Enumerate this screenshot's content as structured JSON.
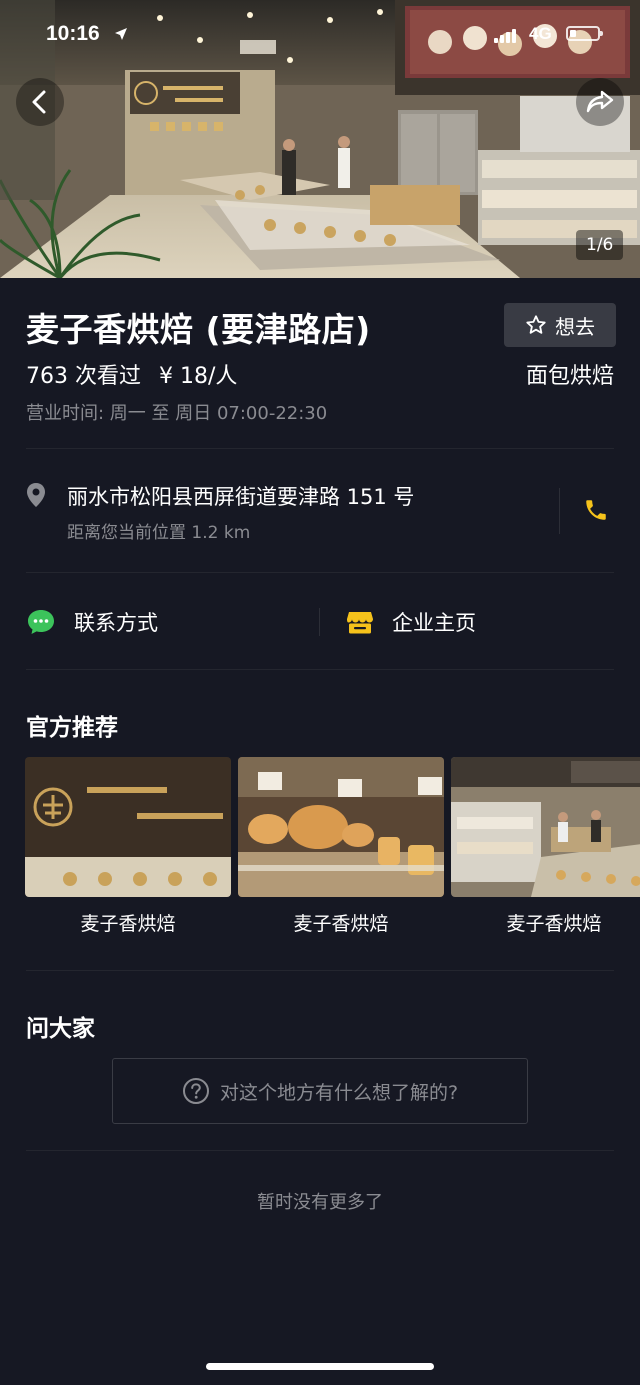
{
  "status_bar": {
    "time": "10:16",
    "network": "4G"
  },
  "hero": {
    "photo_counter": "1/6",
    "icons": {
      "back": "chevron-left-icon",
      "share": "share-arrow-icon"
    }
  },
  "shop": {
    "name": "麦子香烘焙 (要津路店)",
    "want_label": "想去",
    "views": "763 次看过",
    "price": "¥ 18/人",
    "category": "面包烘焙",
    "hours": "营业时间: 周一 至 周日   07:00-22:30"
  },
  "address": {
    "line": "丽水市松阳县西屏街道要津路 151 号",
    "distance": "距离您当前位置 1.2 km"
  },
  "links": {
    "contact": "联系方式",
    "company": "企业主页"
  },
  "recommend": {
    "title": "官方推荐",
    "items": [
      {
        "label": "麦子香烘焙"
      },
      {
        "label": "麦子香烘焙"
      },
      {
        "label": "麦子香烘焙"
      }
    ]
  },
  "ask": {
    "title": "问大家",
    "placeholder": "对这个地方有什么想了解的?"
  },
  "footer": {
    "end_text": "暂时没有更多了"
  },
  "colors": {
    "background": "#161823",
    "accent_yellow": "#f5c21b",
    "wechat_green": "#3cc35b",
    "muted_text": "#8a8b91",
    "button_bg": "#393b44"
  }
}
